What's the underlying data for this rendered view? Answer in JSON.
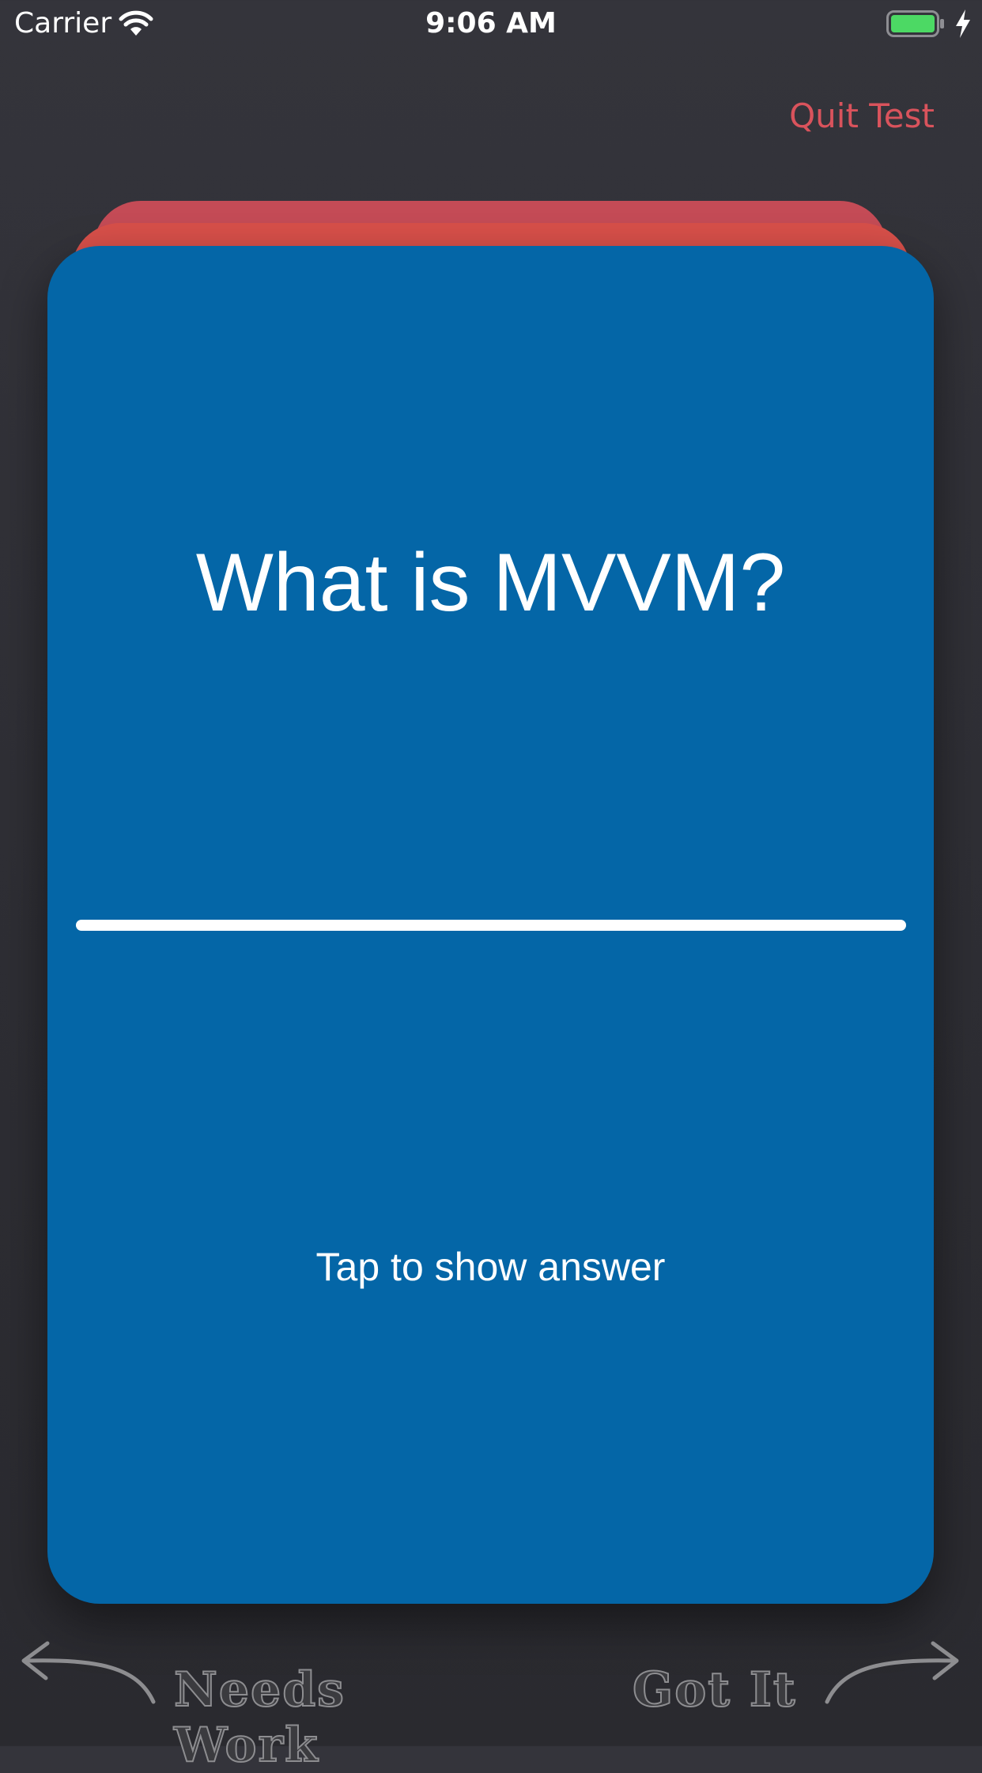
{
  "status_bar": {
    "carrier": "Carrier",
    "time": "9:06 AM",
    "battery_color": "#4cd964"
  },
  "header": {
    "quit_label": "Quit Test"
  },
  "card": {
    "question": "What is MVVM?",
    "hint": "Tap to show answer",
    "color": "#0466a7"
  },
  "stack_colors": [
    "#c44b56",
    "#d8504a"
  ],
  "swipe": {
    "left_label": "Needs Work",
    "right_label": "Got It"
  },
  "accent": "#d9535c"
}
